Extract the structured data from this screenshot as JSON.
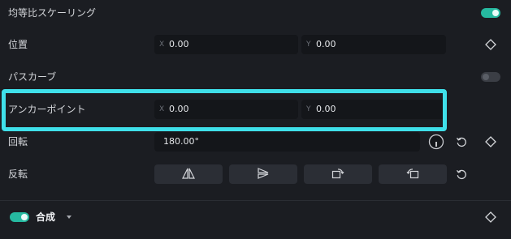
{
  "rows": {
    "uniform_scaling": {
      "label": "均等比スケーリング",
      "enabled": true
    },
    "position": {
      "label": "位置",
      "x_axis": "X",
      "x_value": "0.00",
      "y_axis": "Y",
      "y_value": "0.00"
    },
    "path_curve": {
      "label": "パスカーブ",
      "enabled": false
    },
    "anchor_point": {
      "label": "アンカーポイント",
      "x_axis": "X",
      "x_value": "0.00",
      "y_axis": "Y",
      "y_value": "0.00"
    },
    "rotation": {
      "label": "回転",
      "value": "180.00°"
    },
    "flip": {
      "label": "反転"
    }
  },
  "section": {
    "label": "合成",
    "enabled": true
  },
  "icons": {
    "keyframe": "diamond-icon",
    "reset": "reset-icon",
    "dial": "rotation-dial-icon",
    "flip_horizontal": "flip-horizontal-icon",
    "flip_vertical": "flip-vertical-icon",
    "rotate_right": "rotate-right-icon",
    "rotate_left": "rotate-left-icon",
    "dropdown": "chevron-down-icon"
  },
  "colors": {
    "accent": "#26b9a0",
    "highlight": "#3fe0ea",
    "background": "#1b1d22"
  }
}
